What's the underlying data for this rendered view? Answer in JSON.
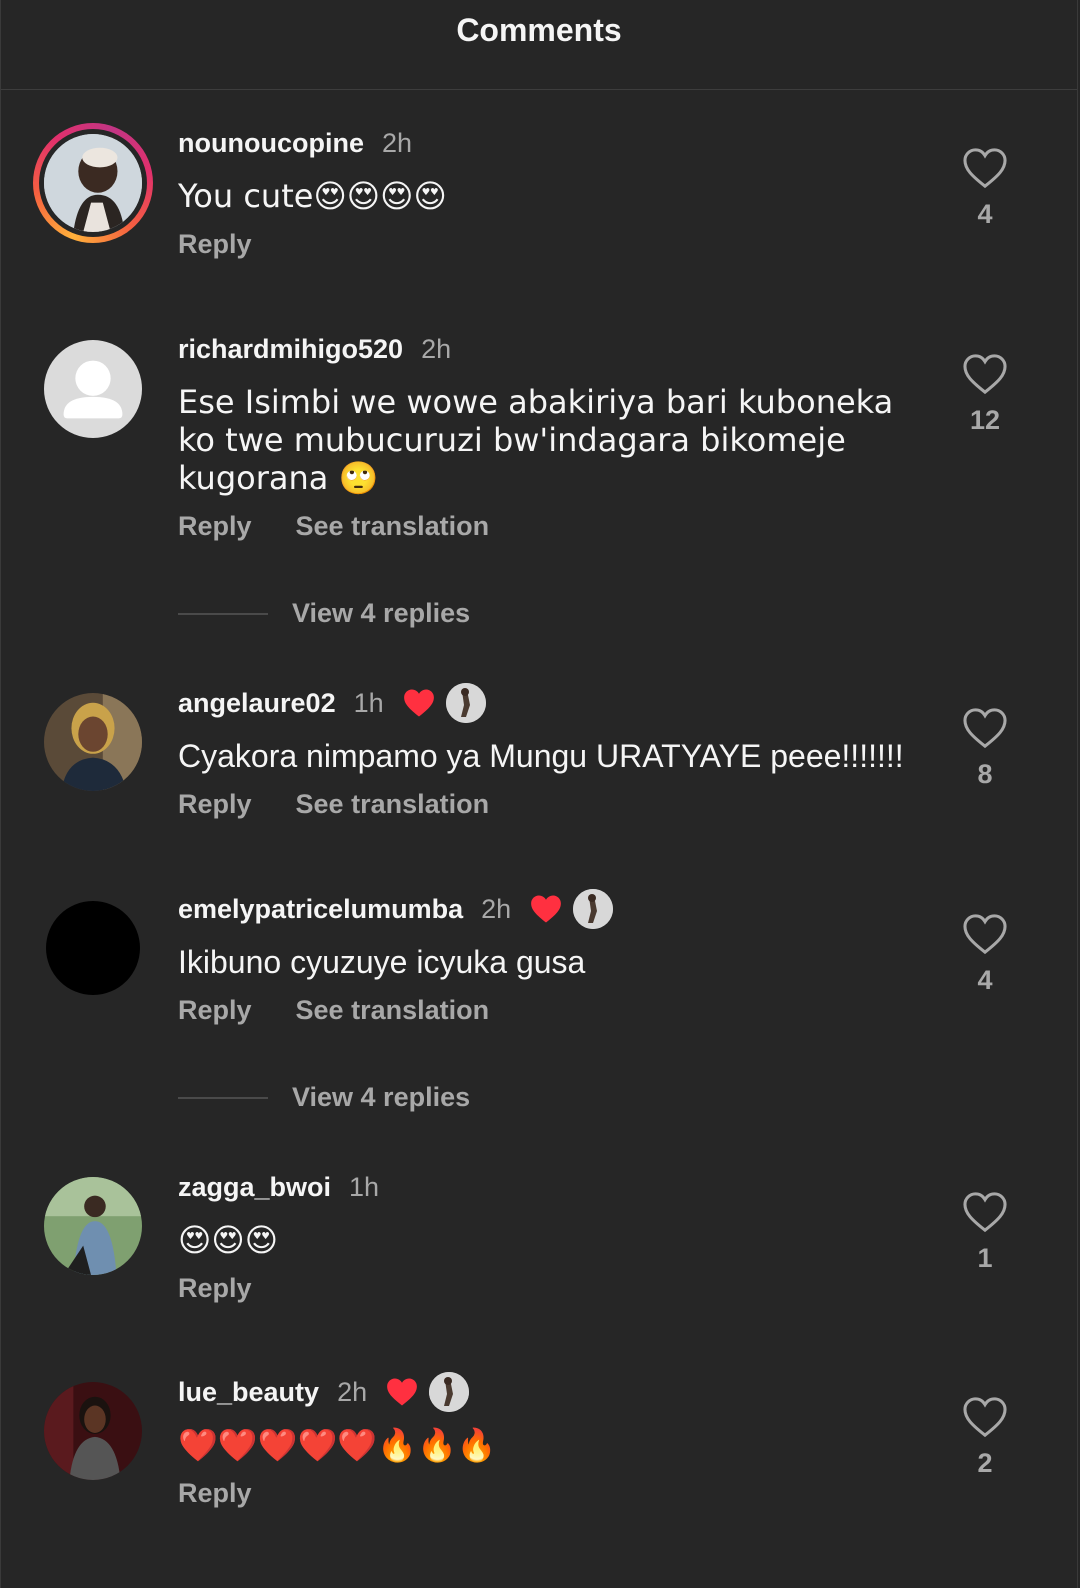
{
  "header": {
    "title": "Comments"
  },
  "comments": [
    {
      "username": "nounoucopine",
      "time": "2h",
      "text": "You cute😍😍😍😍",
      "actions": [
        "Reply"
      ],
      "likes": "4",
      "avatar_icon": "avatar-photo-woman-white-hair",
      "story_ring": true
    },
    {
      "username": "richardmihigo520",
      "time": "2h",
      "text": "Ese Isimbi we wowe abakiriya bari kuboneka ko twe mubucuruzi bw'indagara bikomeje kugorana 🙄",
      "actions": [
        "Reply",
        "See translation"
      ],
      "likes": "12",
      "avatar_icon": "default-avatar-icon"
    },
    {
      "username": "angelaure02",
      "time": "1h",
      "text": "Cyakora nimpamo ya Mungu URATYAYE peee!!!!!!!",
      "actions": [
        "Reply",
        "See translation"
      ],
      "likes": "8",
      "avatar_icon": "avatar-photo-woman-smiling",
      "creator_liked": true
    },
    {
      "username": "emelypatricelumumba",
      "time": "2h",
      "text": "Ikibuno cyuzuye icyuka gusa",
      "actions": [
        "Reply",
        "See translation"
      ],
      "likes": "4",
      "avatar_icon": "avatar-black",
      "creator_liked": true
    },
    {
      "username": "zagga_bwoi",
      "time": "1h",
      "text": "😍😍😍",
      "actions": [
        "Reply"
      ],
      "likes": "1",
      "avatar_icon": "avatar-photo-man-outdoors"
    },
    {
      "username": "lue_beauty",
      "time": "2h",
      "text": "❤️❤️❤️❤️❤️🔥🔥🔥",
      "actions": [
        "Reply"
      ],
      "likes": "2",
      "avatar_icon": "avatar-photo-woman-dark",
      "creator_liked": true
    }
  ],
  "view_replies": [
    {
      "label": "View 4 replies"
    },
    {
      "label": "View 4 replies"
    }
  ],
  "colors": {
    "background": "#262626",
    "text": "#f5f5f5",
    "secondary": "#a8a8a8",
    "heart": "#ff3040"
  }
}
